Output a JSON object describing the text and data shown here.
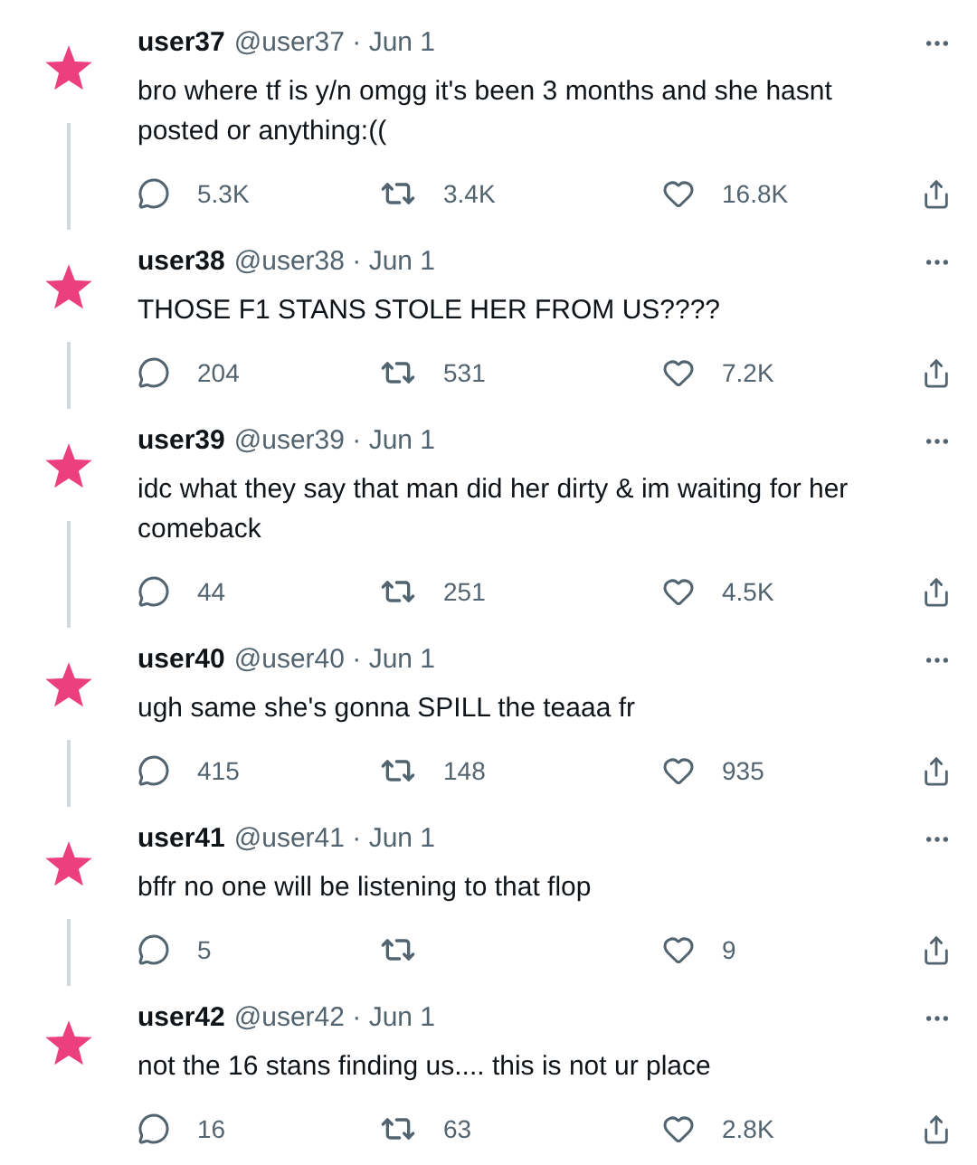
{
  "separator": "·",
  "tweets": [
    {
      "name": "user37",
      "handle": "@user37",
      "date": "Jun 1",
      "text": "bro where tf is y/n omgg it's been 3 months and she hasnt posted or anything:((",
      "replies": "5.3K",
      "retweets": "3.4K",
      "likes": "16.8K"
    },
    {
      "name": "user38",
      "handle": "@user38",
      "date": "Jun 1",
      "text": "THOSE F1 STANS STOLE HER FROM US????",
      "replies": "204",
      "retweets": "531",
      "likes": "7.2K"
    },
    {
      "name": "user39",
      "handle": "@user39",
      "date": "Jun 1",
      "text": "idc what they say that man did her dirty & im waiting for her comeback",
      "replies": "44",
      "retweets": "251",
      "likes": "4.5K"
    },
    {
      "name": "user40",
      "handle": "@user40",
      "date": "Jun 1",
      "text": "ugh same she's gonna SPILL the teaaa fr",
      "replies": "415",
      "retweets": "148",
      "likes": "935"
    },
    {
      "name": "user41",
      "handle": "@user41",
      "date": "Jun 1",
      "text": "bffr no one will be listening to that flop",
      "replies": "5",
      "likes": "9"
    },
    {
      "name": "user42",
      "handle": "@user42",
      "date": "Jun 1",
      "text": "not the 16 stans finding us.... this is not ur place",
      "replies": "16",
      "retweets": "63",
      "likes": "2.8K"
    }
  ]
}
